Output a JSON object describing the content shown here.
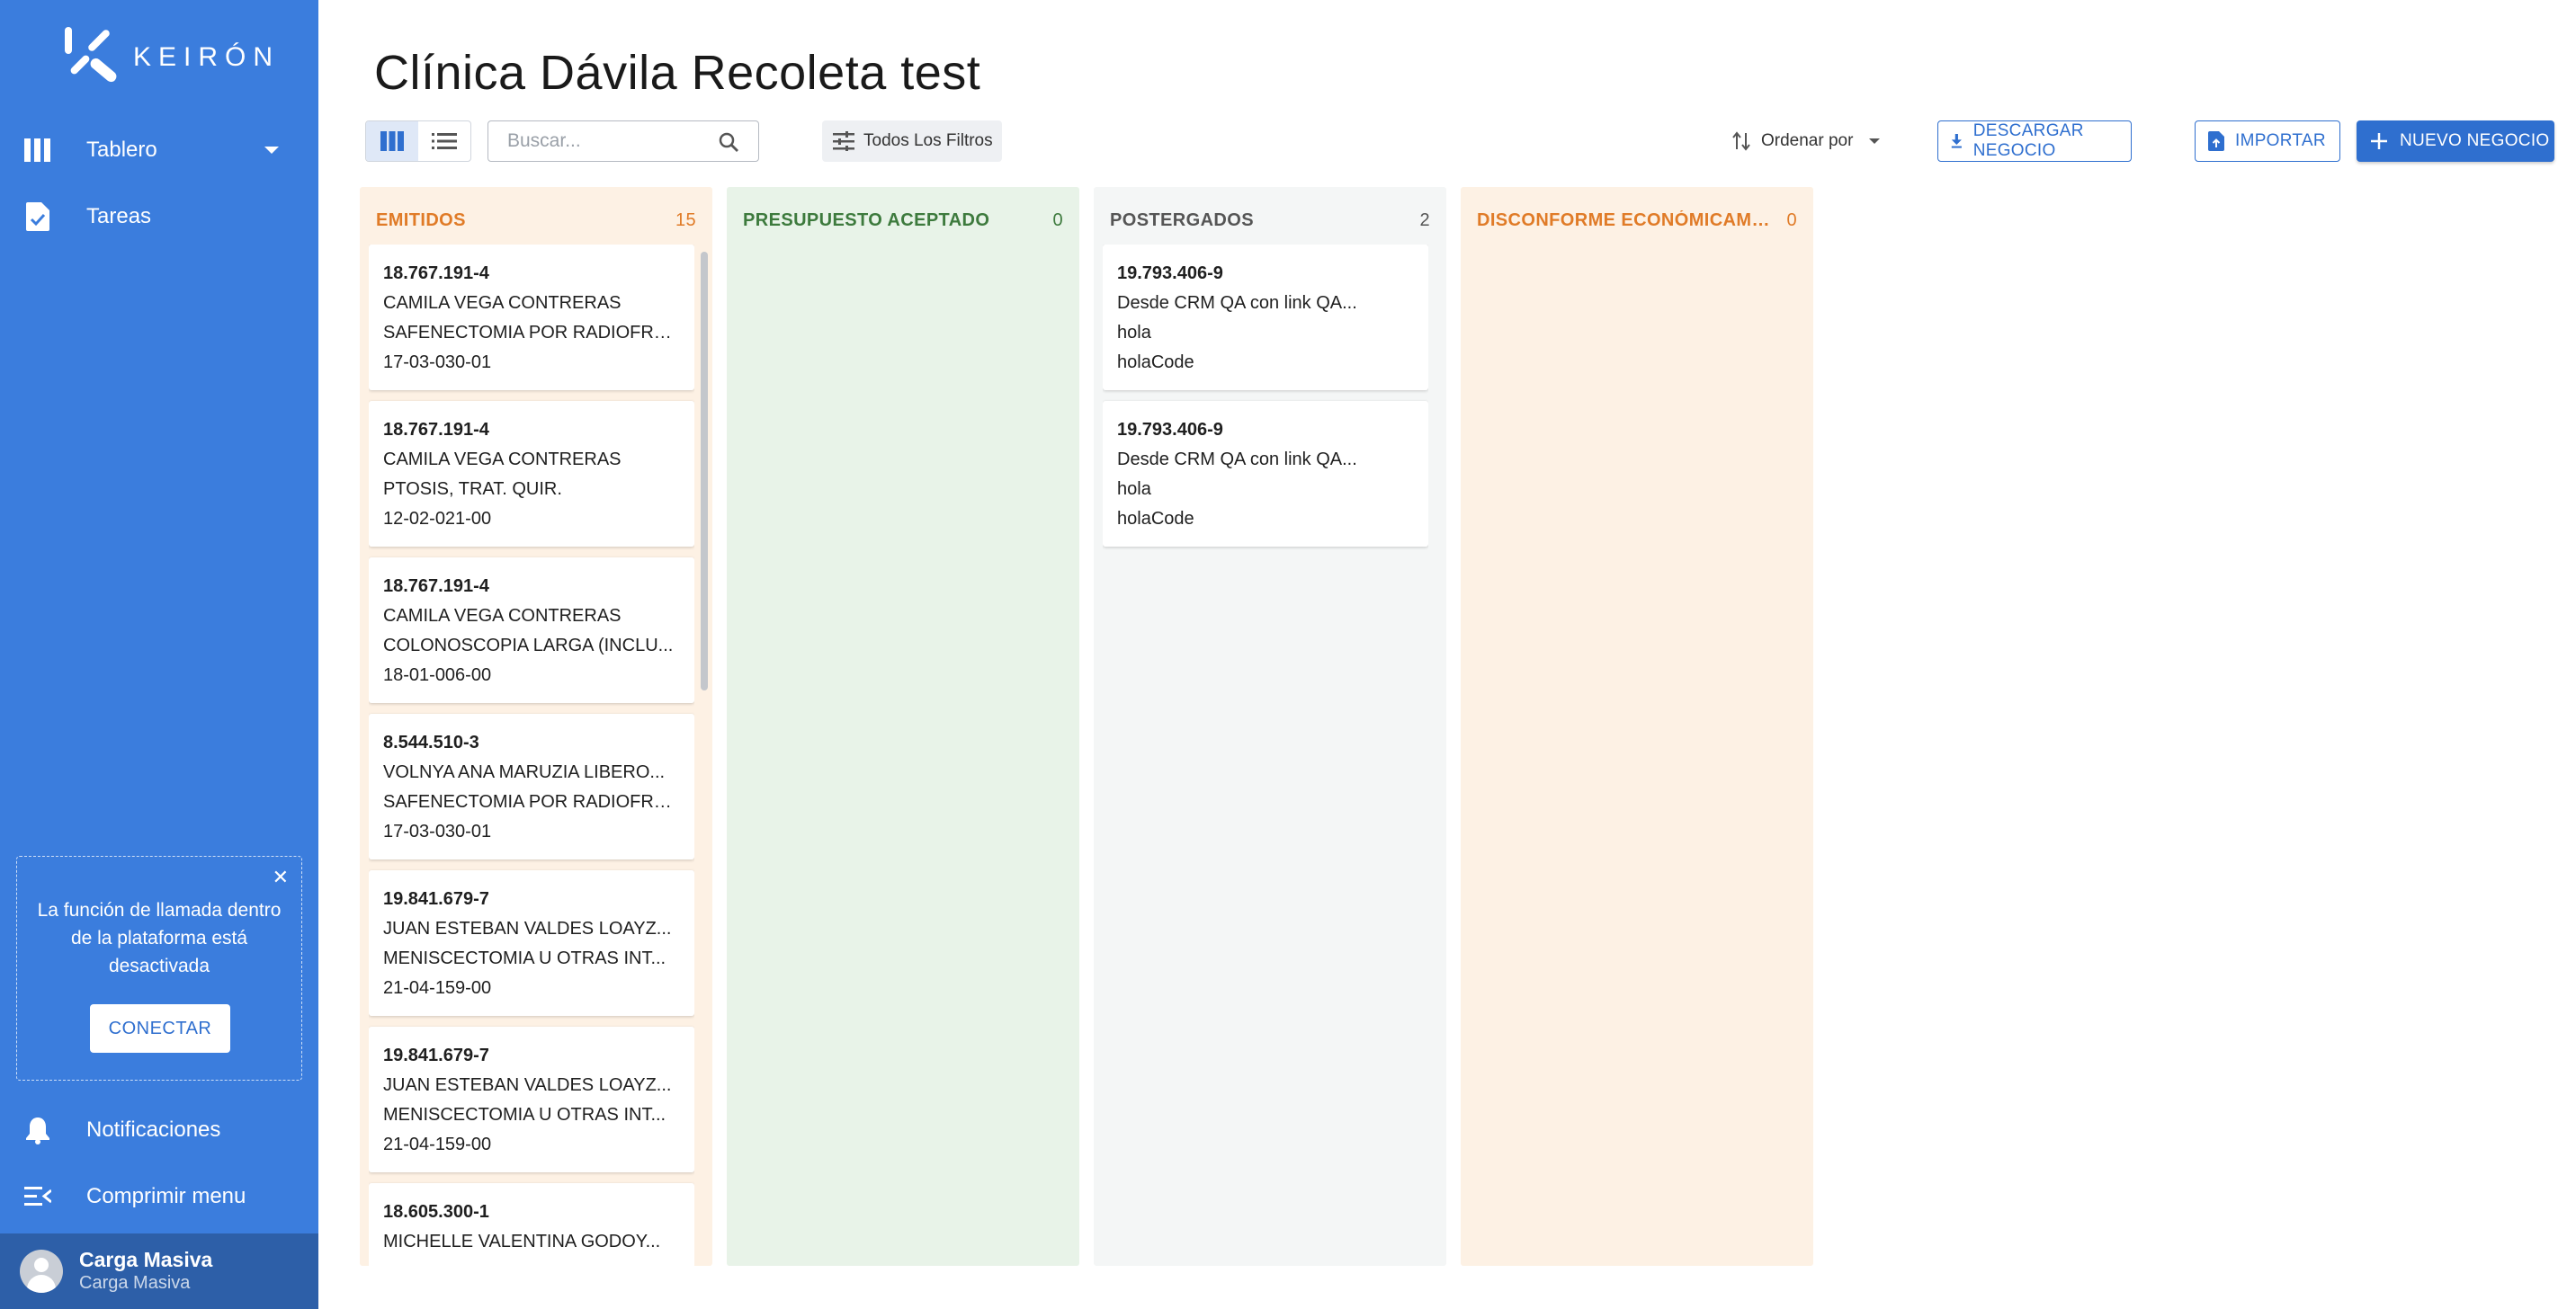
{
  "brand": {
    "logo_text": "KEIRÓN"
  },
  "sidebar": {
    "items": [
      {
        "label": "Tablero",
        "icon": "board-columns-icon"
      },
      {
        "label": "Tareas",
        "icon": "task-document-icon"
      }
    ],
    "call_notice": {
      "text": "La función de llamada dentro de la plataforma está desactivada",
      "button": "CONECTAR"
    },
    "bottom_items": [
      {
        "label": "Notificaciones",
        "icon": "bell-icon"
      },
      {
        "label": "Comprimir menu",
        "icon": "collapse-menu-icon"
      }
    ],
    "user": {
      "name": "Carga Masiva",
      "subtitle": "Carga Masiva"
    }
  },
  "header": {
    "title": "Clínica Dávila Recoleta test"
  },
  "toolbar": {
    "search_placeholder": "Buscar...",
    "filters_label": "Todos Los Filtros",
    "sort_label": "Ordenar por",
    "download_label": "DESCARGAR NEGOCIO",
    "import_label": "IMPORTAR",
    "new_label": "NUEVO NEGOCIO"
  },
  "colors": {
    "sidebar": "#3b7ddd",
    "primary": "#2f6fcf",
    "emitidos_bg": "#fdf1e4",
    "emitidos_text": "#e07b27",
    "aceptado_bg": "#e8f3e8",
    "aceptado_text": "#3d7a3d",
    "postergados_bg": "#f4f6f6",
    "postergados_text": "#555555",
    "disconforme_bg": "#fdf1e4",
    "disconforme_text": "#e07b27"
  },
  "board": {
    "columns": [
      {
        "title": "EMITIDOS",
        "count": "15",
        "cards": [
          {
            "rut": "18.767.191-4",
            "name": "CAMILA VEGA CONTRERAS",
            "procedure": "SAFENECTOMIA POR RADIOFRE...",
            "code": "17-03-030-01"
          },
          {
            "rut": "18.767.191-4",
            "name": "CAMILA VEGA CONTRERAS",
            "procedure": "PTOSIS, TRAT. QUIR.",
            "code": "12-02-021-00"
          },
          {
            "rut": "18.767.191-4",
            "name": "CAMILA VEGA CONTRERAS",
            "procedure": "COLONOSCOPIA LARGA (INCLU...",
            "code": "18-01-006-00"
          },
          {
            "rut": "8.544.510-3",
            "name": "VOLNYA ANA MARUZIA LIBERO...",
            "procedure": "SAFENECTOMIA POR RADIOFRE...",
            "code": "17-03-030-01"
          },
          {
            "rut": "19.841.679-7",
            "name": "JUAN ESTEBAN VALDES LOAYZ...",
            "procedure": "MENISCECTOMIA U OTRAS INT...",
            "code": "21-04-159-00"
          },
          {
            "rut": "19.841.679-7",
            "name": "JUAN ESTEBAN VALDES LOAYZ...",
            "procedure": "MENISCECTOMIA U OTRAS INT...",
            "code": "21-04-159-00"
          },
          {
            "rut": "18.605.300-1",
            "name": "MICHELLE VALENTINA GODOY...",
            "procedure": "",
            "code": ""
          }
        ]
      },
      {
        "title": "PRESUPUESTO ACEPTADO",
        "count": "0",
        "cards": []
      },
      {
        "title": "POSTERGADOS",
        "count": "2",
        "cards": [
          {
            "rut": "19.793.406-9",
            "name": "Desde CRM QA con link QA...",
            "procedure": "hola",
            "code": "holaCode"
          },
          {
            "rut": "19.793.406-9",
            "name": "Desde CRM QA con link QA...",
            "procedure": "hola",
            "code": "holaCode"
          }
        ]
      },
      {
        "title": "DISCONFORME ECONÓMICAMEN...",
        "count": "0",
        "cards": []
      }
    ]
  }
}
